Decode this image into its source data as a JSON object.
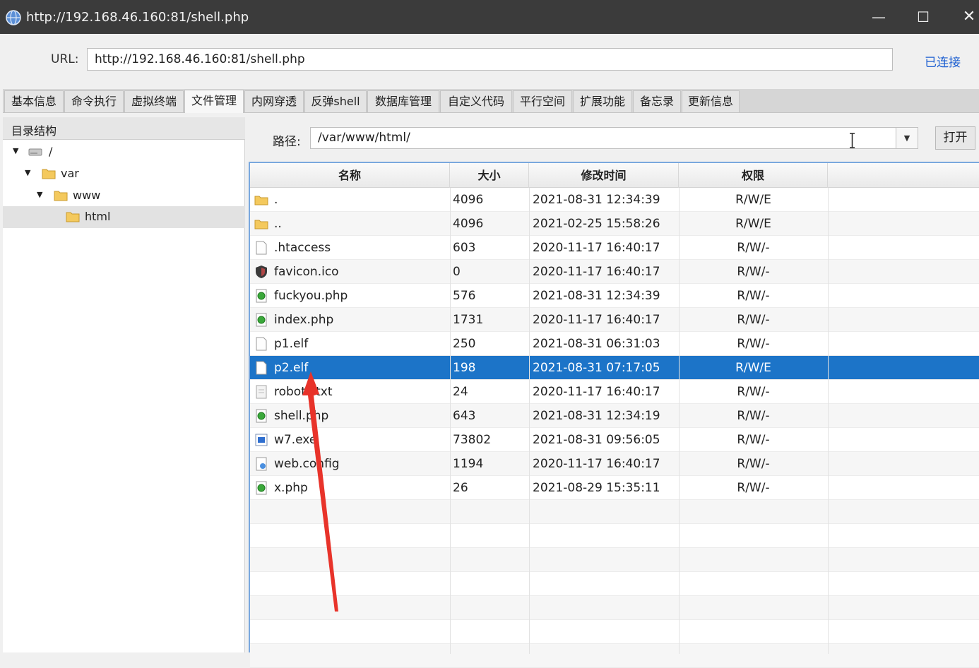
{
  "window": {
    "title": "http://192.168.46.160:81/shell.php",
    "minimize": "—",
    "maximize": "☐",
    "close": "✕"
  },
  "url_bar": {
    "label": "URL:",
    "value": "http://192.168.46.160:81/shell.php",
    "status": "已连接"
  },
  "tabs": [
    {
      "label": "基本信息"
    },
    {
      "label": "命令执行"
    },
    {
      "label": "虚拟终端"
    },
    {
      "label": "文件管理",
      "active": true
    },
    {
      "label": "内网穿透"
    },
    {
      "label": "反弹shell"
    },
    {
      "label": "数据库管理"
    },
    {
      "label": "自定义代码"
    },
    {
      "label": "平行空间"
    },
    {
      "label": "扩展功能"
    },
    {
      "label": "备忘录"
    },
    {
      "label": "更新信息"
    }
  ],
  "tree": {
    "header": "目录结构",
    "nodes": [
      {
        "label": "/",
        "icon": "drive-icon"
      },
      {
        "label": "var",
        "icon": "folder-icon"
      },
      {
        "label": "www",
        "icon": "folder-icon"
      },
      {
        "label": "html",
        "icon": "folder-icon",
        "selected": true
      }
    ]
  },
  "path_bar": {
    "label": "路径:",
    "value": "/var/www/html/",
    "open_button": "打开",
    "dropdown_icon": "▼"
  },
  "file_table": {
    "columns": [
      "名称",
      "大小",
      "修改时间",
      "权限"
    ],
    "rows": [
      {
        "name": ".",
        "size": "4096",
        "mtime": "2021-08-31 12:34:39",
        "perm": "R/W/E",
        "icon": "folder"
      },
      {
        "name": "..",
        "size": "4096",
        "mtime": "2021-02-25 15:58:26",
        "perm": "R/W/E",
        "icon": "folder"
      },
      {
        "name": ".htaccess",
        "size": "603",
        "mtime": "2020-11-17 16:40:17",
        "perm": "R/W/-",
        "icon": "file"
      },
      {
        "name": "favicon.ico",
        "size": "0",
        "mtime": "2020-11-17 16:40:17",
        "perm": "R/W/-",
        "icon": "ico"
      },
      {
        "name": "fuckyou.php",
        "size": "576",
        "mtime": "2021-08-31 12:34:39",
        "perm": "R/W/-",
        "icon": "php"
      },
      {
        "name": "index.php",
        "size": "1731",
        "mtime": "2020-11-17 16:40:17",
        "perm": "R/W/-",
        "icon": "php"
      },
      {
        "name": "p1.elf",
        "size": "250",
        "mtime": "2021-08-31 06:31:03",
        "perm": "R/W/-",
        "icon": "file"
      },
      {
        "name": "p2.elf",
        "size": "198",
        "mtime": "2021-08-31 07:17:05",
        "perm": "R/W/E",
        "icon": "file",
        "selected": true
      },
      {
        "name": "robots.txt",
        "size": "24",
        "mtime": "2020-11-17 16:40:17",
        "perm": "R/W/-",
        "icon": "txt"
      },
      {
        "name": "shell.php",
        "size": "643",
        "mtime": "2021-08-31 12:34:19",
        "perm": "R/W/-",
        "icon": "php"
      },
      {
        "name": "w7.exe",
        "size": "73802",
        "mtime": "2021-08-31 09:56:05",
        "perm": "R/W/-",
        "icon": "exe"
      },
      {
        "name": "web.config",
        "size": "1194",
        "mtime": "2020-11-17 16:40:17",
        "perm": "R/W/-",
        "icon": "config"
      },
      {
        "name": "x.php",
        "size": "26",
        "mtime": "2021-08-29 15:35:11",
        "perm": "R/W/-",
        "icon": "php"
      }
    ]
  },
  "colors": {
    "selection": "#1c74c8",
    "accent_link": "#1d5fd1",
    "annotation_arrow": "#e8332a"
  }
}
